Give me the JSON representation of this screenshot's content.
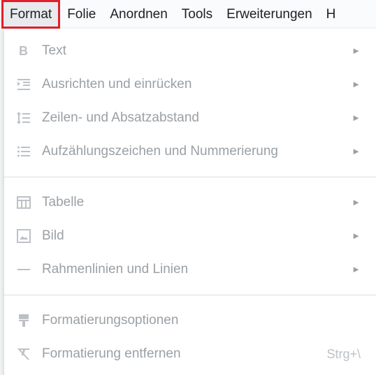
{
  "menubar": {
    "items": [
      "Format",
      "Folie",
      "Anordnen",
      "Tools",
      "Erweiterungen",
      "H"
    ],
    "active_item": "Format"
  },
  "dropdown": {
    "section1": [
      {
        "label": "Text",
        "icon": "bold-icon",
        "has_submenu": true
      },
      {
        "label": "Ausrichten und einrücken",
        "icon": "indent-icon",
        "has_submenu": true
      },
      {
        "label": "Zeilen- und Absatzabstand",
        "icon": "line-spacing-icon",
        "has_submenu": true
      },
      {
        "label": "Aufzählungszeichen und Nummerierung",
        "icon": "bulleted-list-icon",
        "has_submenu": true
      }
    ],
    "section2": [
      {
        "label": "Tabelle",
        "icon": "table-icon",
        "has_submenu": true
      },
      {
        "label": "Bild",
        "icon": "image-icon",
        "has_submenu": true
      },
      {
        "label": "Rahmenlinien und Linien",
        "icon": "border-line-icon",
        "has_submenu": true
      }
    ],
    "section3": [
      {
        "label": "Formatierungsoptionen",
        "icon": "paint-roller-icon",
        "has_submenu": false
      },
      {
        "label": "Formatierung entfernen",
        "icon": "clear-formatting-icon",
        "has_submenu": false,
        "shortcut": "Strg+\\"
      }
    ],
    "submenu_arrow": "►",
    "colors": {
      "disabled_text": "#9aa0a6",
      "highlight_border": "#e0202a"
    }
  }
}
